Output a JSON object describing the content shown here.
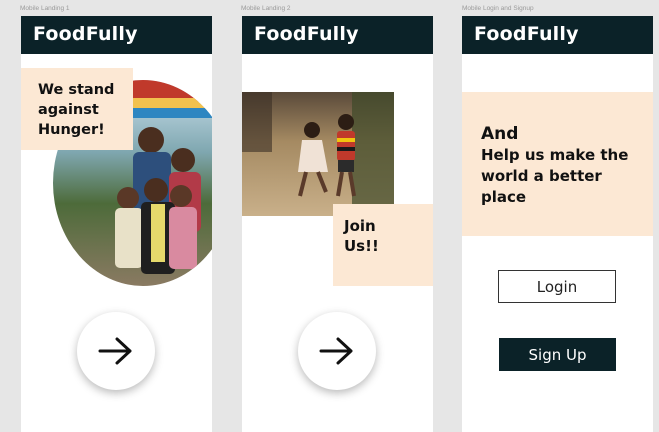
{
  "frames": [
    {
      "label": "Mobile Landing 1",
      "brand": "FoodFully",
      "tagline": [
        "We stand",
        "against",
        "Hunger!"
      ],
      "next_icon": "arrow-right-icon"
    },
    {
      "label": "Mobile Landing 2",
      "brand": "FoodFully",
      "tagline": [
        "Join",
        "Us!!"
      ],
      "next_icon": "arrow-right-icon"
    },
    {
      "label": "Mobile Login and Signup",
      "brand": "FoodFully",
      "tagline": [
        "And",
        "Help us make the",
        "world a better",
        "place"
      ],
      "login_label": "Login",
      "signup_label": "Sign Up"
    }
  ],
  "colors": {
    "header": "#0b2228",
    "accent_peach": "#fce8d4",
    "canvas": "#e6e6e6"
  }
}
